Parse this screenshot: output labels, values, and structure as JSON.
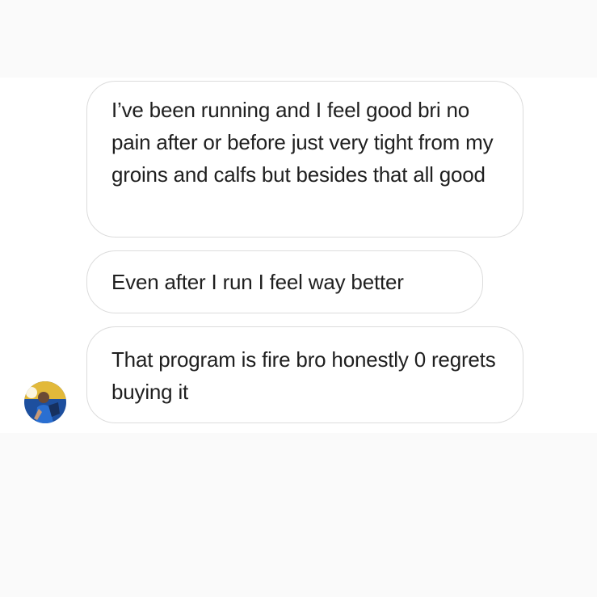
{
  "messages": [
    {
      "text": "I’ve been running and I feel good bri no pain after or before just very tight from my groins and calfs but besides that all good"
    },
    {
      "text": "Even after I run I feel way better"
    },
    {
      "text": "That program is fire bro honestly 0 regrets buying it"
    }
  ],
  "avatar": {
    "icon": "profile-photo-icon",
    "colors": [
      "#1d4f9e",
      "#e2b93a",
      "#ffffff"
    ]
  }
}
